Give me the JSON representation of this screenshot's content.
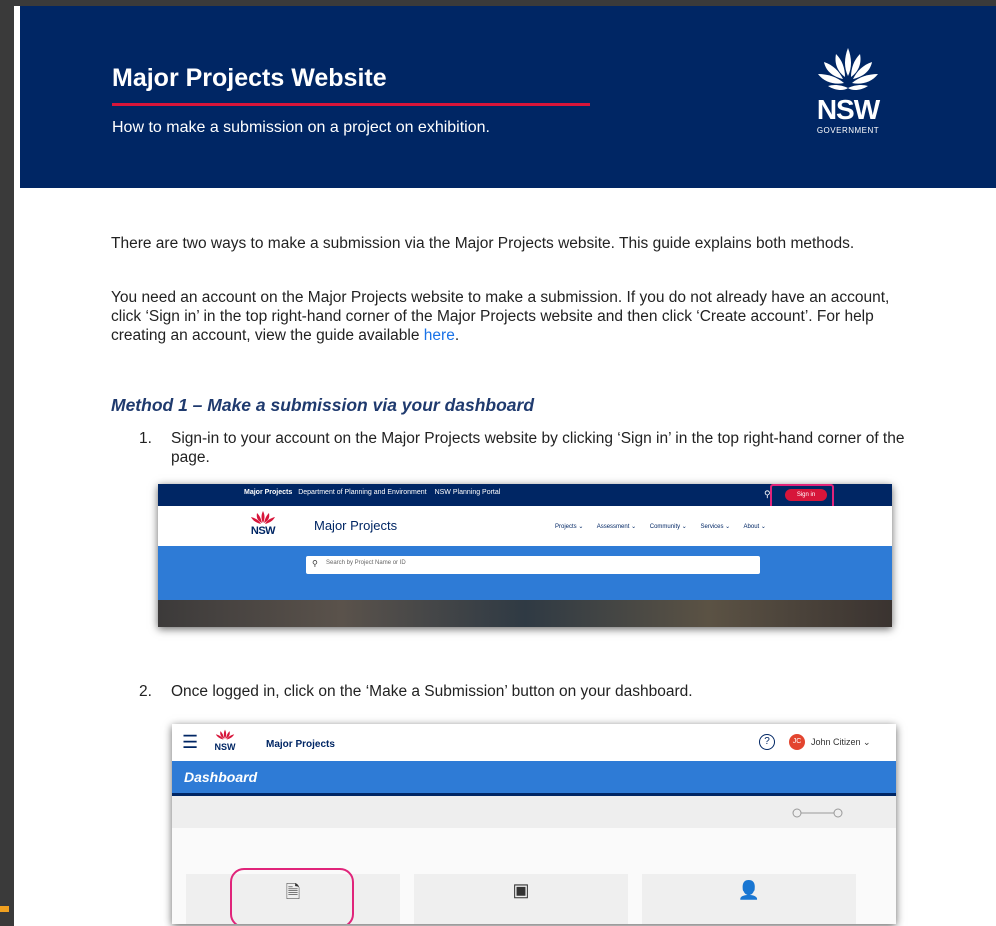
{
  "banner": {
    "title": "Major Projects Website",
    "subtitle": "How to make a submission on a project on exhibition.",
    "logo_word": "NSW",
    "logo_sub": "GOVERNMENT"
  },
  "intro": {
    "para1": "There are two ways to make a submission via the Major Projects website. This guide explains both methods.",
    "para2_text": "You need an account on the Major Projects website to make a submission. If you do not already have an account, click ‘Sign in’ in the top right-hand corner of the Major Projects website and then click ‘Create account’. For help creating an account, view the guide available ",
    "para2_link": "here",
    "para2_end": "."
  },
  "method1": {
    "heading": "Method 1 – Make a submission via your dashboard",
    "step1_num": "1.",
    "step1_text": "Sign-in to your account on the Major Projects website by clicking ‘Sign in’ in the top right-hand corner of the page.",
    "step2_num": "2.",
    "step2_text": "Once logged in, click on the ‘Make a Submission’ button on your dashboard."
  },
  "screenshot1": {
    "top_links": [
      "Major Projects",
      "Department of Planning and Environment",
      "NSW Planning Portal"
    ],
    "sign_in": "Sign in",
    "logo_word": "NSW",
    "site_title": "Major Projects",
    "menu": [
      "Projects ⌄",
      "Assessment ⌄",
      "Community ⌄",
      "Services ⌄",
      "About ⌄"
    ],
    "search_placeholder": "Search by Project Name or ID"
  },
  "screenshot2": {
    "logo_word": "NSW",
    "site_title": "Major Projects",
    "help": "?",
    "avatar": "JC",
    "user": "John Citizen ⌄",
    "dashboard": "Dashboard"
  },
  "colors": {
    "nsw_navy": "#002664",
    "nsw_red": "#d7153a",
    "highlight_pink": "#e0247a",
    "link_blue": "#1a73e8",
    "bar_blue": "#2e7bd6"
  }
}
